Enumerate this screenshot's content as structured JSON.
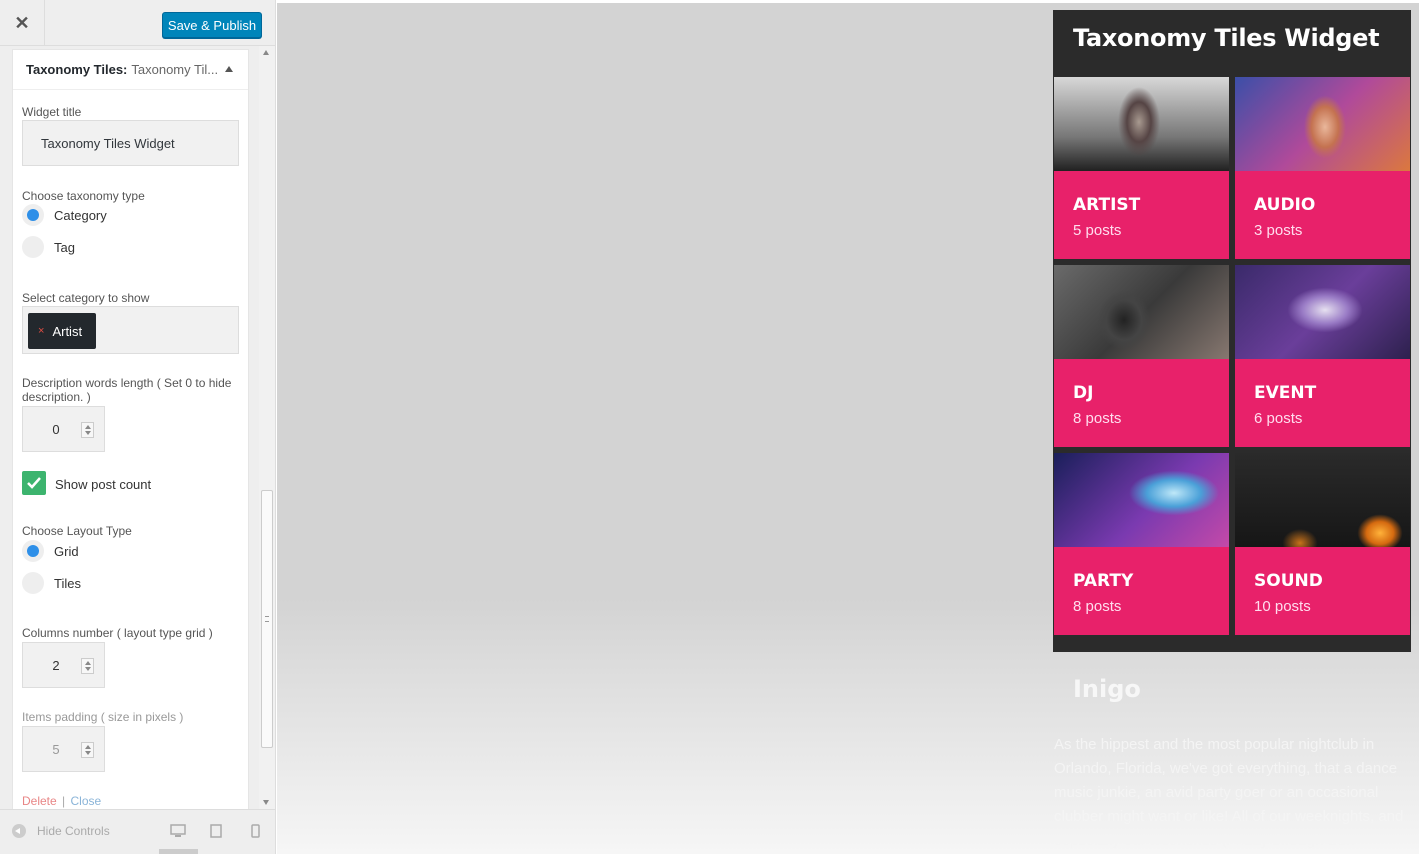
{
  "topbar": {
    "close_glyph": "✕",
    "publish_label": "Save & Publish"
  },
  "widget": {
    "header_title": "Taxonomy Tiles:",
    "header_sub": "Taxonomy Til...",
    "fields": {
      "title_label": "Widget title",
      "title_value": "Taxonomy Tiles Widget",
      "taxonomy_label": "Choose taxonomy type",
      "taxonomy_options": [
        "Category",
        "Tag"
      ],
      "taxonomy_selected": "Category",
      "category_label": "Select category to show",
      "category_chip": "Artist",
      "chip_remove": "×",
      "desc_label": "Description words length ( Set 0 to hide description. )",
      "desc_value": "0",
      "show_count_label": "Show post count",
      "show_count_checked": true,
      "layout_label": "Choose Layout Type",
      "layout_options": [
        "Grid",
        "Tiles"
      ],
      "layout_selected": "Grid",
      "columns_label": "Columns number ( layout type grid )",
      "columns_value": "2",
      "padding_label": "Items padding ( size in pixels )",
      "padding_value": "5"
    },
    "links": {
      "delete": "Delete",
      "sep": "|",
      "close": "Close"
    }
  },
  "footer": {
    "hide_controls": "Hide Controls",
    "device_icons": [
      "desktop-icon",
      "tablet-icon",
      "mobile-icon"
    ]
  },
  "preview": {
    "widget_title": "Taxonomy Tiles Widget",
    "tiles": [
      {
        "name": "ARTIST",
        "count": "5 posts"
      },
      {
        "name": "AUDIO",
        "count": "3 posts"
      },
      {
        "name": "DJ",
        "count": "8 posts"
      },
      {
        "name": "EVENT",
        "count": "6 posts"
      },
      {
        "name": "PARTY",
        "count": "8 posts"
      },
      {
        "name": "SOUND",
        "count": "10 posts"
      }
    ],
    "site_name": "Inigo",
    "about_text": "As the hippest and the most popular nightclub in Orlando, Florida, we've got everything, that a dance music junkie, an avid party goer or an occasional clubber might want or like! All of our weeknights, and especially our weekends (Friday through Sun-"
  },
  "colors": {
    "accent": "#0085ba",
    "tile_band": "#e8216a",
    "checkbox": "#3cb46e",
    "radio_on": "#2e8fe8"
  }
}
